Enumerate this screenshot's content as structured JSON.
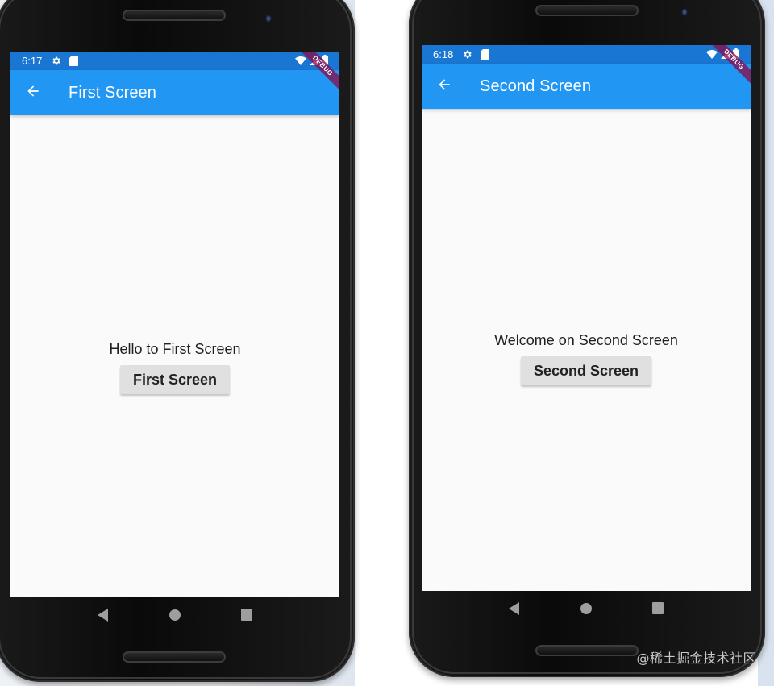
{
  "phones": [
    {
      "status": {
        "time": "6:17"
      },
      "appbar": {
        "title": "First Screen"
      },
      "debug_label": "DEBUG",
      "body": {
        "message": "Hello to First Screen",
        "button_label": "First Screen"
      }
    },
    {
      "status": {
        "time": "6:18"
      },
      "appbar": {
        "title": "Second Screen"
      },
      "debug_label": "DEBUG",
      "body": {
        "message": "Welcome on Second Screen",
        "button_label": "Second Screen"
      }
    }
  ],
  "icons": {
    "back": "arrow-back-icon",
    "settings": "gear-icon",
    "sd_card": "sd-card-icon",
    "wifi": "wifi-icon",
    "signal": "signal-icon",
    "battery": "battery-icon",
    "nav_back": "triangle-back-icon",
    "nav_home": "circle-home-icon",
    "nav_recents": "square-recents-icon"
  },
  "colors": {
    "status_bar": "#1976d2",
    "app_bar": "#2196f3",
    "debug_banner": "#880e4f",
    "button_bg": "#e0e0e0",
    "screen_bg": "#fafafa"
  },
  "watermark": "@稀土掘金技术社区"
}
